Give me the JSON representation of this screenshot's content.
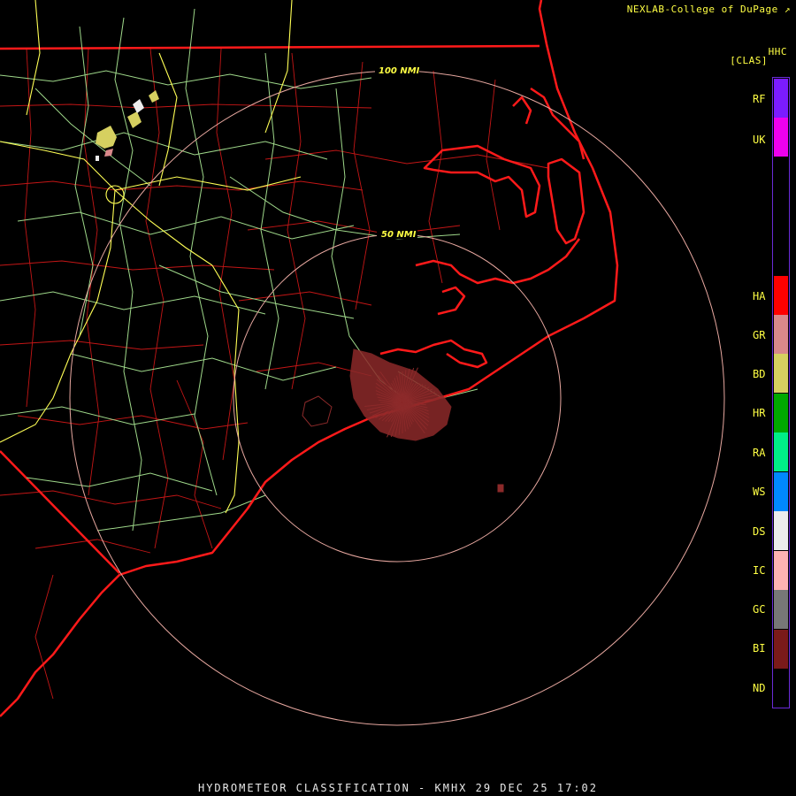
{
  "header": {
    "credit": "NEXLAB-College of DuPage",
    "credit_icon": "arrow-icon",
    "product_code": "HHC",
    "product_name": "[CLAS]"
  },
  "rings": [
    {
      "label": "50 NMI"
    },
    {
      "label": "100 NMI"
    }
  ],
  "legend": {
    "classes": [
      {
        "code": "RF",
        "color": "#7b1cff"
      },
      {
        "code": "UK",
        "color": "#ee00ee"
      },
      {
        "code": "HA",
        "color": "#ff0000"
      },
      {
        "code": "GR",
        "color": "#d9888a"
      },
      {
        "code": "BD",
        "color": "#d6d060"
      },
      {
        "code": "HR",
        "color": "#00a800"
      },
      {
        "code": "RA",
        "color": "#00ee88"
      },
      {
        "code": "WS",
        "color": "#0088ff"
      },
      {
        "code": "DS",
        "color": "#ececec"
      },
      {
        "code": "IC",
        "color": "#ffb3b3"
      },
      {
        "code": "GC",
        "color": "#777777"
      },
      {
        "code": "BI",
        "color": "#7a1a1a"
      },
      {
        "code": "ND",
        "color": "#000000"
      }
    ]
  },
  "footer": {
    "title": "HYDROMETEOR CLASSIFICATION - KMHX 29 DEC 25 17:02"
  },
  "colors": {
    "coast": "#ff1a1a",
    "county": "#cc1818",
    "highway": "#a8e08a",
    "interstate": "#ffff55",
    "ring": "#e8a8a0",
    "clutter": "#8c2a2a"
  }
}
